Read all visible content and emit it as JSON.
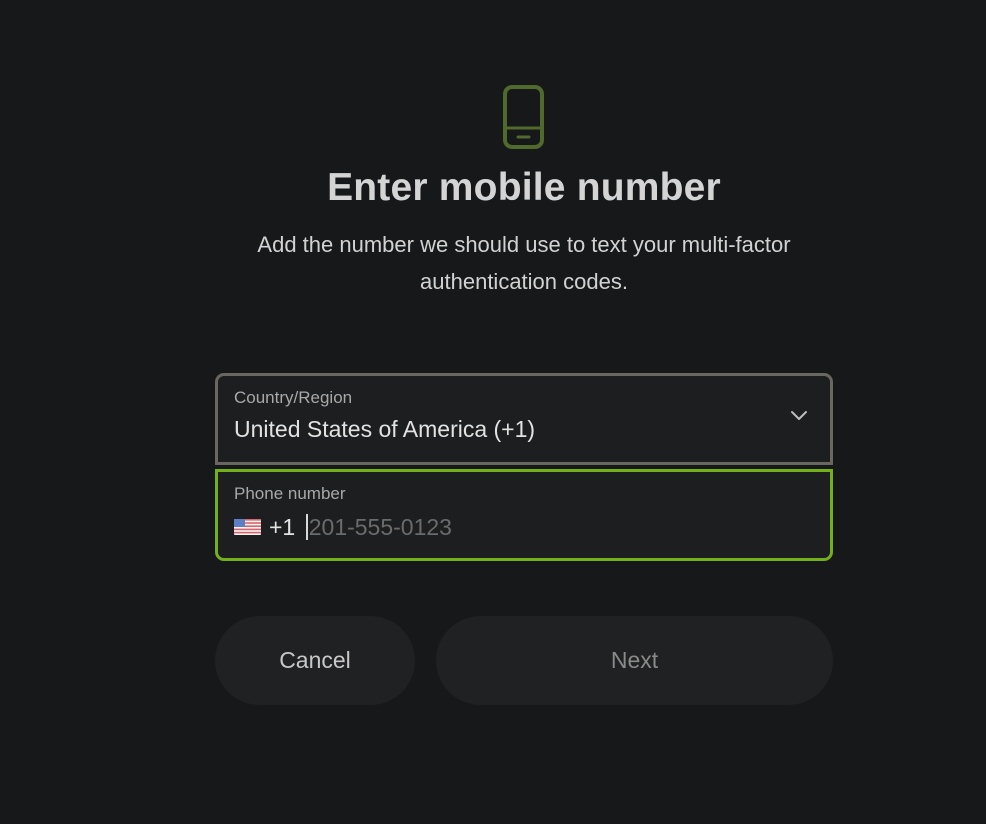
{
  "header": {
    "icon": "mobile-phone-icon",
    "title": "Enter mobile number",
    "subtitle": "Add the number we should use to text your multi-factor authentication codes."
  },
  "country_field": {
    "label": "Country/Region",
    "value": "United States of America (+1)",
    "icon": "chevron-down-icon"
  },
  "phone_field": {
    "label": "Phone number",
    "flag_icon": "us-flag-icon",
    "dial_code": "+1",
    "value": "",
    "placeholder": "201-555-0123"
  },
  "actions": {
    "cancel_label": "Cancel",
    "next_label": "Next"
  },
  "colors": {
    "background": "#171819",
    "accent": "#72b11a",
    "icon": "#4f6a2c"
  }
}
